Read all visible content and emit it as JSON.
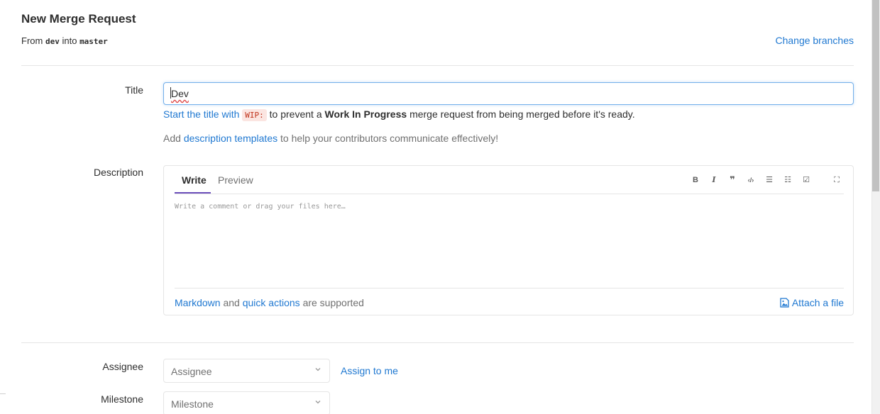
{
  "header": {
    "title": "New Merge Request",
    "from_word": "From",
    "source_branch": "dev",
    "into_word": "into",
    "target_branch": "master",
    "change_branches": "Change branches"
  },
  "title_field": {
    "label": "Title",
    "value": "Dev",
    "help_link": "Start the title with",
    "help_code": "WIP:",
    "help_mid": "to prevent a",
    "help_bold": "Work In Progress",
    "help_end": "merge request from being merged before it's ready.",
    "templates_pre": "Add",
    "templates_link": "description templates",
    "templates_post": "to help your contributors communicate effectively!"
  },
  "description": {
    "label": "Description",
    "tabs": [
      "Write",
      "Preview"
    ],
    "active_tab": "Write",
    "toolbar": {
      "bold": "B",
      "italic": "I",
      "quote": "❞",
      "code": "‹/›",
      "bullet_list": "☰",
      "numbered_list": "☷",
      "task_list": "☑",
      "fullscreen": "⛶"
    },
    "placeholder": "Write a comment or drag your files here…",
    "footer_link1": "Markdown",
    "footer_and": "and",
    "footer_link2": "quick actions",
    "footer_post": "are supported",
    "attach_label": "Attach a file"
  },
  "assignee": {
    "label": "Assignee",
    "value": "Assignee",
    "assign_to_me": "Assign to me"
  },
  "milestone": {
    "label": "Milestone",
    "value": "Milestone"
  },
  "colors": {
    "link": "#1f78d1",
    "tab_underline": "#6b4fbb",
    "focus_border": "#73afea",
    "code_text": "#c0341d",
    "code_bg": "#fbe5e1"
  },
  "icons": {
    "attach": "image-file-icon",
    "chevron": "chevron-down-icon"
  }
}
